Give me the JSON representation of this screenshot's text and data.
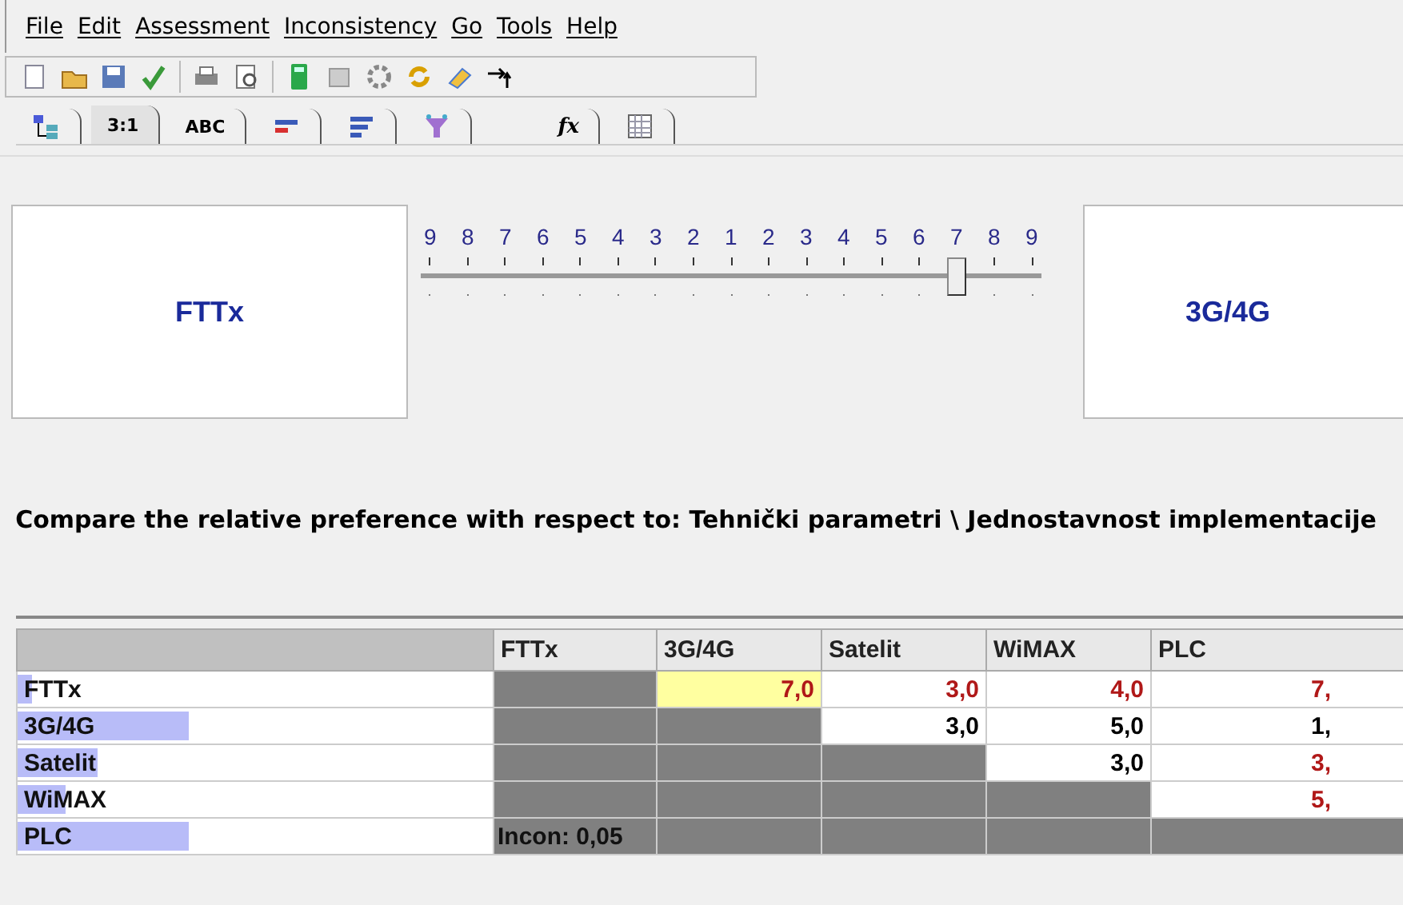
{
  "menu": [
    "File",
    "Edit",
    "Assessment",
    "Inconsistency",
    "Go",
    "Tools",
    "Help"
  ],
  "tabs": [
    {
      "kind": "icon",
      "selected": false
    },
    {
      "kind": "text",
      "label": "3:1",
      "selected": true
    },
    {
      "kind": "text",
      "label": "ABC",
      "selected": false
    },
    {
      "kind": "icon",
      "selected": false
    },
    {
      "kind": "icon",
      "selected": false
    },
    {
      "kind": "icon",
      "selected": false
    },
    {
      "kind": "text",
      "label": "fx",
      "selected": false
    },
    {
      "kind": "icon",
      "selected": false
    }
  ],
  "comparison": {
    "left": "FTTx",
    "right": "3G/4G",
    "scale": [
      "9",
      "8",
      "7",
      "6",
      "5",
      "4",
      "3",
      "2",
      "1",
      "2",
      "3",
      "4",
      "5",
      "6",
      "7",
      "8",
      "9"
    ],
    "level": 0.875
  },
  "question": "Compare the relative preference with respect to: Tehnički parametri  \\ Jednostavnost implementacije",
  "matrix": {
    "columns": [
      "FTTx",
      "3G/4G",
      "Satelit",
      "WiMAX",
      "PLC"
    ],
    "rows": [
      {
        "name": "FTTx",
        "level": 0.03,
        "cells": [
          {
            "kind": "blank"
          },
          {
            "kind": "value",
            "text": "7,0",
            "inverted": true,
            "selected": true
          },
          {
            "kind": "value",
            "text": "3,0",
            "inverted": true,
            "selected": false
          },
          {
            "kind": "value",
            "text": "4,0",
            "inverted": true,
            "selected": false
          },
          {
            "kind": "value",
            "text": "7,",
            "inverted": true,
            "selected": false
          }
        ]
      },
      {
        "name": "3G/4G",
        "level": 0.36,
        "cells": [
          {
            "kind": "blank"
          },
          {
            "kind": "blank"
          },
          {
            "kind": "value",
            "text": "3,0",
            "inverted": false,
            "selected": false
          },
          {
            "kind": "value",
            "text": "5,0",
            "inverted": false,
            "selected": false
          },
          {
            "kind": "value",
            "text": "1,",
            "inverted": false,
            "selected": false
          }
        ]
      },
      {
        "name": "Satelit",
        "level": 0.17,
        "cells": [
          {
            "kind": "blank"
          },
          {
            "kind": "blank"
          },
          {
            "kind": "blank"
          },
          {
            "kind": "value",
            "text": "3,0",
            "inverted": false,
            "selected": false
          },
          {
            "kind": "value",
            "text": "3,",
            "inverted": true,
            "selected": false
          }
        ]
      },
      {
        "name": "WiMAX",
        "level": 0.1,
        "cells": [
          {
            "kind": "blank"
          },
          {
            "kind": "blank"
          },
          {
            "kind": "blank"
          },
          {
            "kind": "blank"
          },
          {
            "kind": "value",
            "text": "5,",
            "inverted": true,
            "selected": false
          }
        ]
      },
      {
        "name": "PLC",
        "level": 0.36,
        "cells": [
          {
            "kind": "note",
            "text": "Incon: 0,05"
          },
          {
            "kind": "blank"
          },
          {
            "kind": "blank"
          },
          {
            "kind": "blank"
          },
          {
            "kind": "blank"
          }
        ]
      }
    ]
  }
}
